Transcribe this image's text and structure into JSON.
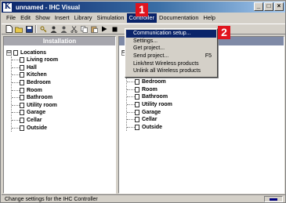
{
  "window": {
    "title": "unnamed - IHC Visual",
    "app_icon": "K",
    "controls": {
      "minimize": "_",
      "maximize": "□",
      "close": "×"
    }
  },
  "menubar": [
    "File",
    "Edit",
    "Show",
    "Insert",
    "Library",
    "Simulation",
    "Controller",
    "Documentation",
    "Help"
  ],
  "toolbar": {
    "icons": [
      "new-file-icon",
      "open-folder-icon",
      "save-icon",
      "key-icon",
      "user-icon",
      "user-add-icon",
      "cut-icon",
      "copy-icon",
      "paste-icon",
      "play-icon",
      "stop-icon"
    ]
  },
  "left_pane": {
    "header": "Installation",
    "root_label": "Locations",
    "expander": "⊟",
    "items": [
      "Living room",
      "Hall",
      "Kitchen",
      "Bedroom",
      "Room",
      "Bathroom",
      "Utility room",
      "Garage",
      "Cellar",
      "Outside"
    ]
  },
  "right_pane": {
    "header": "",
    "expander": "⊟",
    "items": [
      "Bedroom",
      "Room",
      "Bathroom",
      "Utility room",
      "Garage",
      "Cellar",
      "Outside"
    ]
  },
  "controller_menu": {
    "items": [
      {
        "label": "Communication setup...",
        "shortcut": ""
      },
      {
        "label": "Settings...",
        "shortcut": ""
      },
      {
        "label": "Get project...",
        "shortcut": ""
      },
      {
        "label": "Send project...",
        "shortcut": "F5"
      },
      {
        "label": "Link/test Wireless products",
        "shortcut": ""
      },
      {
        "label": "Unlink all Wireless products",
        "shortcut": ""
      }
    ]
  },
  "callouts": {
    "one": "1",
    "two": "2"
  },
  "statusbar": {
    "text": "Change settings for the IHC Controller"
  },
  "colors": {
    "titlebar": "#0a246a",
    "highlight": "#0a246a",
    "callout": "#e0141e"
  }
}
